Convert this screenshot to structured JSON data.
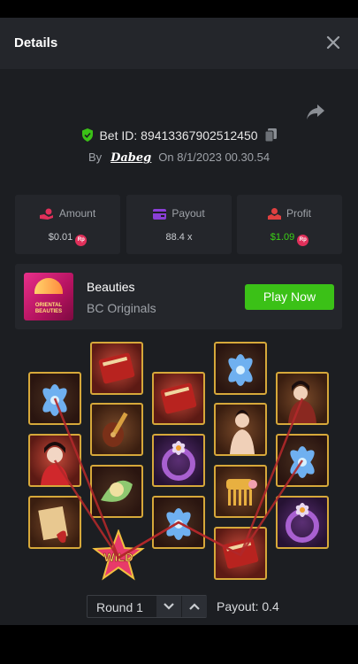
{
  "header": {
    "title": "Details"
  },
  "bet": {
    "id_text": "Bet ID: 89413367902512450",
    "by_label": "By",
    "username": "Dabeg",
    "on_label": "On",
    "datetime": "8/1/2023 00.30.54"
  },
  "stats": {
    "amount": {
      "label": "Amount",
      "value": "$0.01",
      "coin": "Rp"
    },
    "payout": {
      "label": "Payout",
      "value": "88.4 x"
    },
    "profit": {
      "label": "Profit",
      "value": "$1.09",
      "coin": "Rp"
    }
  },
  "game": {
    "name": "Beauties",
    "provider": "BC Originals",
    "play_label": "Play Now",
    "thumb_text": "ORIENTAL BEAUTIES"
  },
  "reels": {
    "wild_text": "WILD"
  },
  "footer": {
    "round_label": "Round 1",
    "payout_text": "Payout: 0.4"
  },
  "colors": {
    "accent_green": "#3bc117",
    "tile_border": "#d6a83a",
    "win_line": "#b0282a"
  }
}
